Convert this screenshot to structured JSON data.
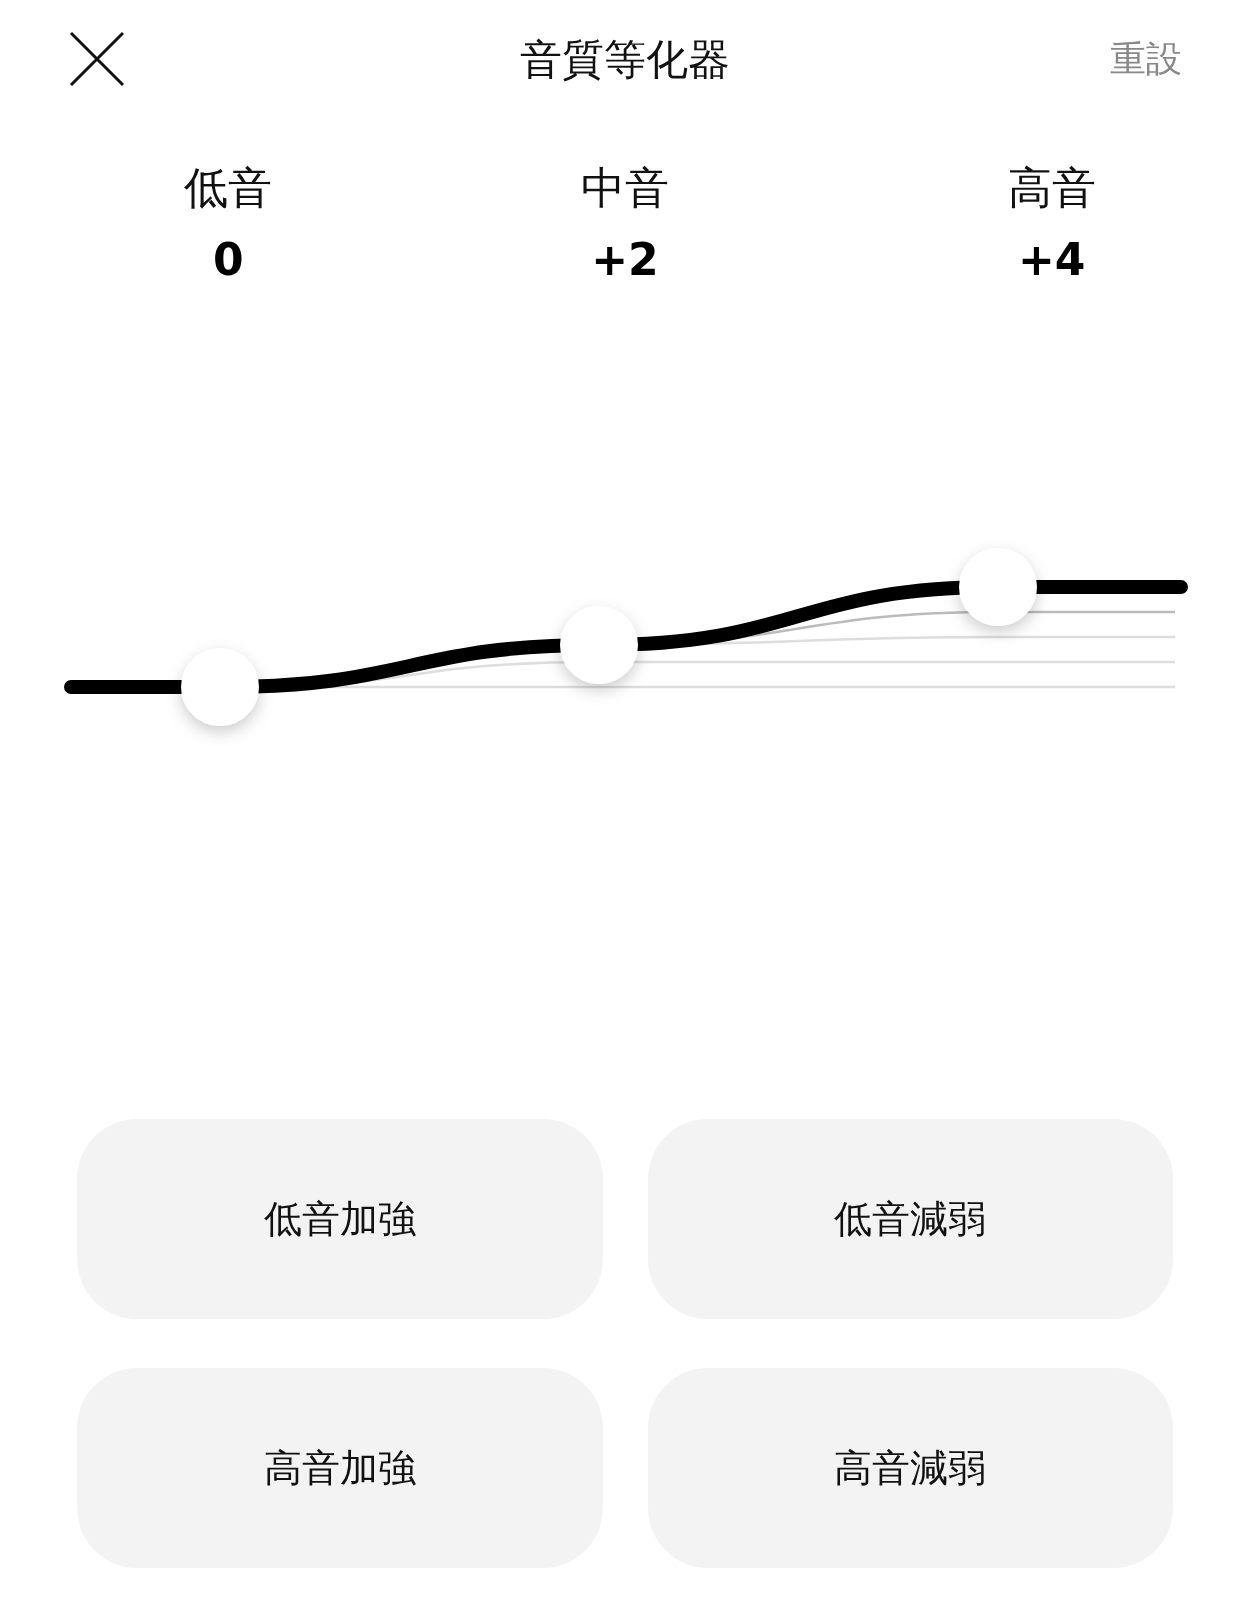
{
  "header": {
    "title": "音質等化器",
    "reset": "重設"
  },
  "bands": [
    {
      "label": "低音",
      "value": "0"
    },
    {
      "label": "中音",
      "value": "+2"
    },
    {
      "label": "高音",
      "value": "+4"
    }
  ],
  "presets": [
    "低音加強",
    "低音減弱",
    "高音加強",
    "高音減弱"
  ]
}
